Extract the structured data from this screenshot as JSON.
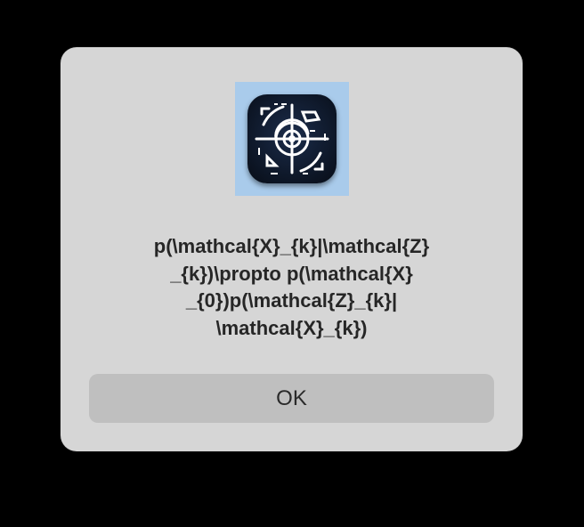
{
  "dialog": {
    "icon": "app-logo-icon",
    "message_lines": [
      "p(\\mathcal{X}_{k}|\\mathcal{Z}",
      "_{k})\\propto p(\\mathcal{X}",
      "_{0})p(\\mathcal{Z}_{k}|",
      "\\mathcal{X}_{k})"
    ],
    "ok_label": "OK"
  },
  "colors": {
    "backdrop": "#000000",
    "dialog_bg": "#d6d6d6",
    "button_bg": "#bfbfbf",
    "icon_bg": "#a9cbeb",
    "icon_tile": "#0d1626"
  }
}
